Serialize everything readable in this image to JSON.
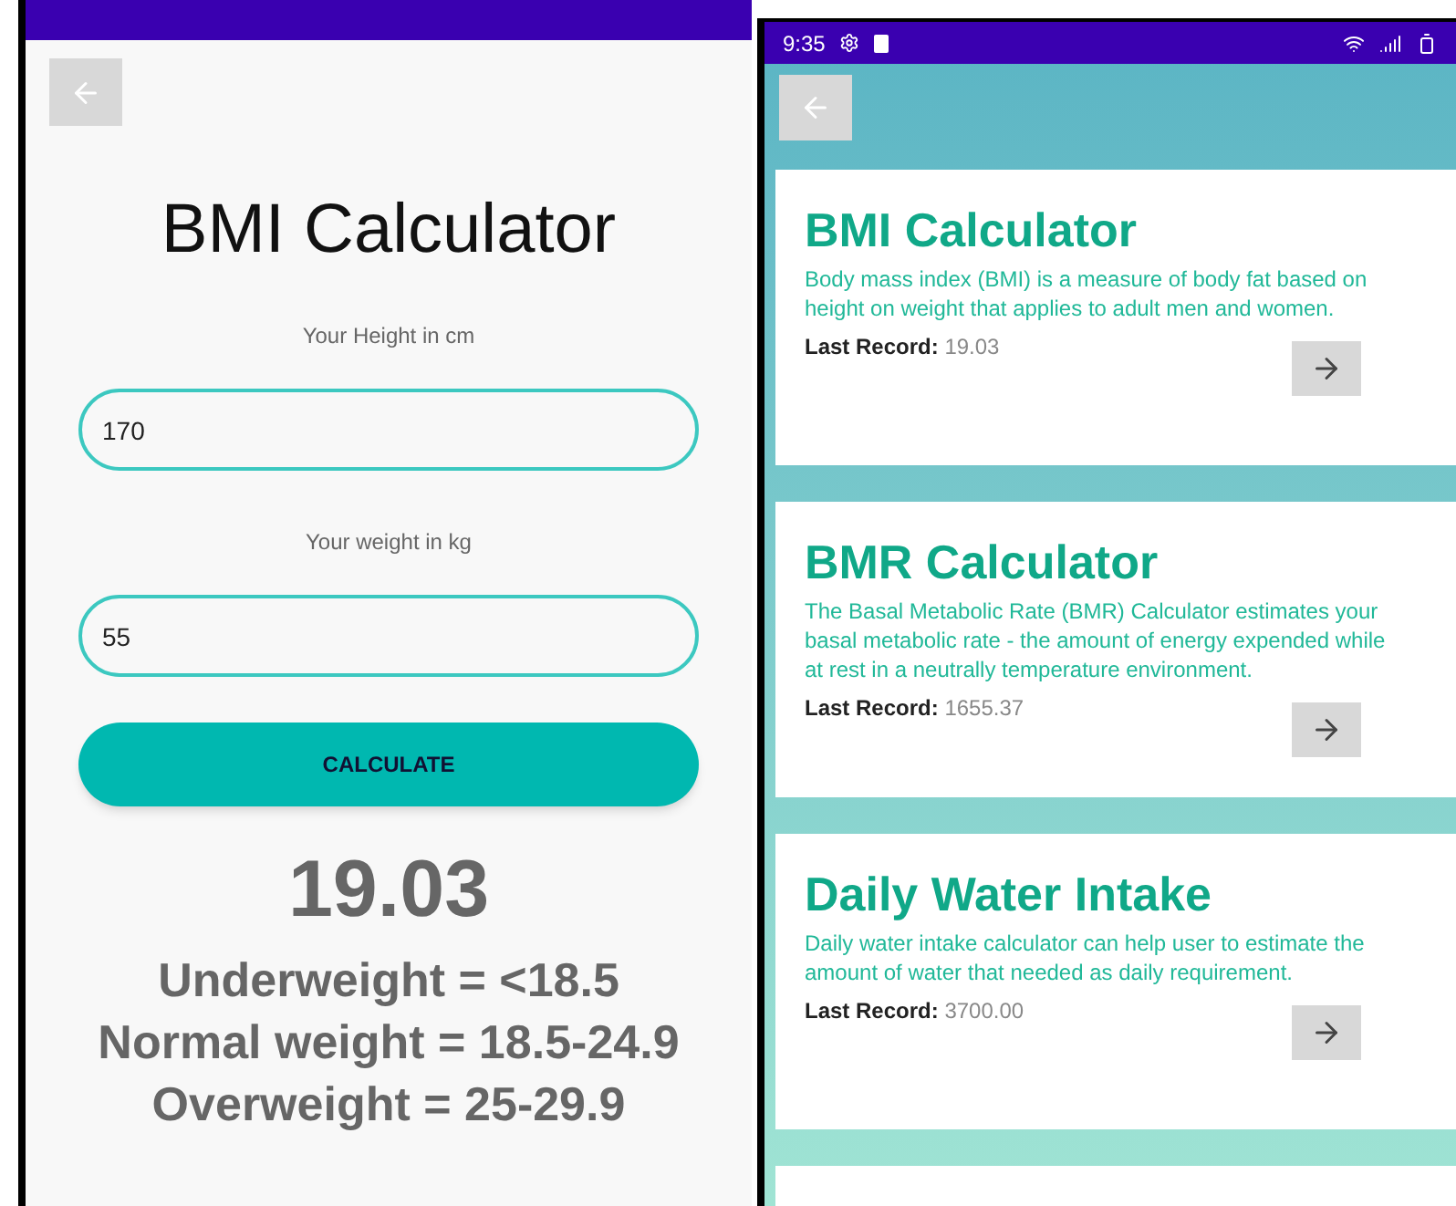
{
  "left_screen": {
    "title": "BMI Calculator",
    "fields": [
      {
        "label": "Your Height in cm",
        "value": "170"
      },
      {
        "label": "Your weight in kg",
        "value": "55"
      }
    ],
    "button": "CALCULATE",
    "result": "19.03",
    "categories": [
      "Underweight = <18.5",
      "Normal weight = 18.5-24.9",
      "Overweight = 25-29.9"
    ]
  },
  "right_screen": {
    "status_bar": {
      "time": "9:35"
    },
    "cards": [
      {
        "title": "BMI Calculator",
        "description": "Body mass index (BMI) is a measure of body fat based on height on weight that applies to adult men and women.",
        "record_label": "Last Record:",
        "record_value": "19.03"
      },
      {
        "title": "BMR Calculator",
        "description": "The Basal Metabolic Rate (BMR) Calculator estimates your basal metabolic rate - the amount of energy expended while at rest in a neutrally temperature environment.",
        "record_label": "Last Record:",
        "record_value": "1655.37"
      },
      {
        "title": "Daily Water Intake",
        "description": "Daily water intake calculator can help user to estimate the amount of water that needed as daily requirement.",
        "record_label": "Last Record:",
        "record_value": "3700.00"
      }
    ]
  }
}
